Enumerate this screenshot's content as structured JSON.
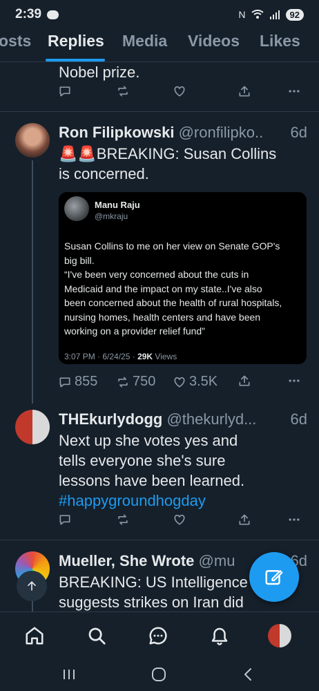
{
  "status_bar": {
    "time": "2:39",
    "battery": "92"
  },
  "tabs": [
    {
      "label": "osts"
    },
    {
      "label": "Replies"
    },
    {
      "label": "Media"
    },
    {
      "label": "Videos"
    },
    {
      "label": "Likes"
    }
  ],
  "active_tab": "Replies",
  "posts": [
    {
      "text": "Nobel prize.",
      "actions": {
        "reply": "",
        "repost": "",
        "like": ""
      }
    },
    {
      "name": "Ron Filipkowski",
      "handle": "@ronfilipko..",
      "time": "6d",
      "text_line1": "🚨🚨BREAKING: Susan Collins",
      "text_line2": "is concerned.",
      "quote": {
        "name": "Manu Raju",
        "handle": "@mkraju",
        "body_line1": "Susan Collins to me on her view on Senate GOP's",
        "body_line2": "big bill.",
        "body_line3": "“I've been very concerned about the cuts in",
        "body_line4": "Medicaid and the impact on my state..I've also",
        "body_line5": "been concerned about the health of rural hospitals,",
        "body_line6": "nursing homes, health centers and have been",
        "body_line7": "working on a provider relief fund”",
        "meta_time": "3:07 PM · 6/24/25 · ",
        "meta_views_count": "29K",
        "meta_views_label": " Views"
      },
      "actions": {
        "reply": "855",
        "repost": "750",
        "like": "3.5K"
      }
    },
    {
      "name": "THEkurlydogg",
      "handle": "@thekurlyd...",
      "time": "6d",
      "text_line1": "Next up she votes yes and",
      "text_line2": "tells everyone she's sure",
      "text_line3": "lessons have been learned.",
      "hashtag": "#happygroundhogday",
      "actions": {
        "reply": "",
        "repost": "",
        "like": ""
      }
    },
    {
      "name": "Mueller, She Wrote",
      "handle": "@mu",
      "time": "6d",
      "text_line1": "BREAKING: US Intelligence",
      "text_line2": "suggests strikes on Iran did"
    }
  ],
  "icons": {
    "compose": "compose-icon",
    "home": "home-icon",
    "search": "search-icon",
    "grok": "chat-bubble-icon",
    "notifications": "bell-icon"
  },
  "colors": {
    "accent": "#1d9bf0",
    "background": "#15202b",
    "muted": "#8b98a5"
  }
}
